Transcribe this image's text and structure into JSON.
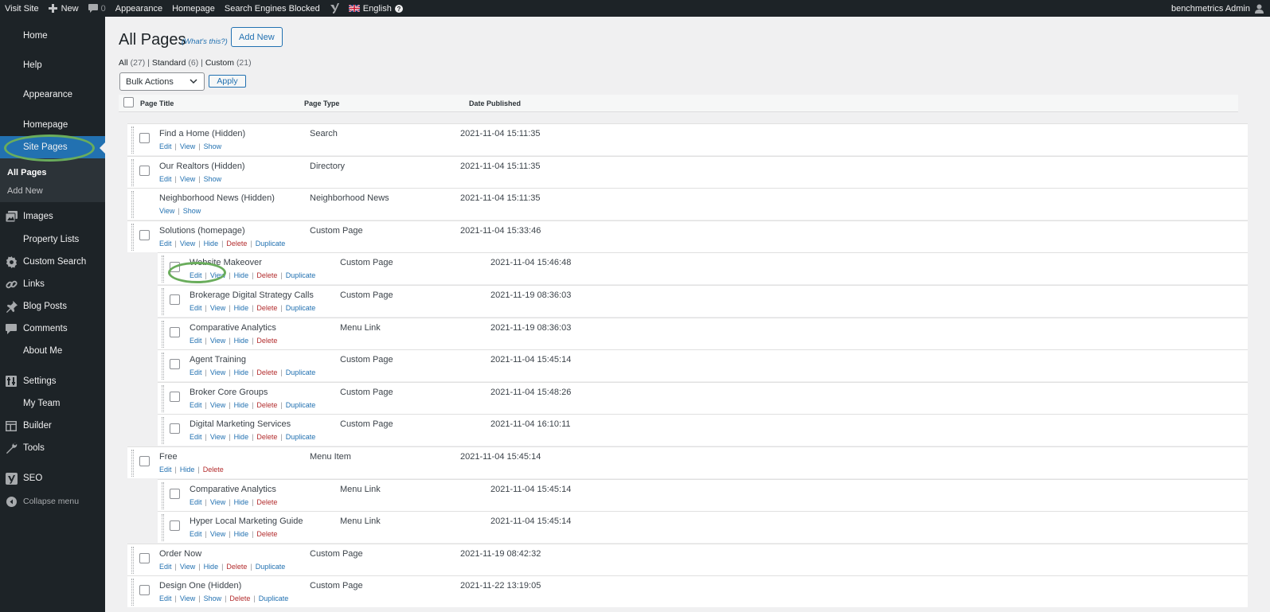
{
  "admin_bar": {
    "visit_site": "Visit Site",
    "new": "New",
    "comments_count": "0",
    "appearance": "Appearance",
    "homepage": "Homepage",
    "search_engines": "Search Engines Blocked",
    "language": "English",
    "user": "benchmetrics Admin"
  },
  "sidebar": {
    "items": [
      {
        "label": "Home",
        "icon": "none"
      },
      {
        "label": "Help",
        "icon": "none"
      },
      {
        "label": "Appearance",
        "icon": "none"
      },
      {
        "label": "Homepage",
        "icon": "none"
      },
      {
        "label": "Site Pages",
        "icon": "none"
      },
      {
        "label": "Images",
        "icon": "images-icon"
      },
      {
        "label": "Property Lists",
        "icon": "none"
      },
      {
        "label": "Custom Search",
        "icon": "gear-icon"
      },
      {
        "label": "Links",
        "icon": "link-icon"
      },
      {
        "label": "Blog Posts",
        "icon": "pin-icon"
      },
      {
        "label": "Comments",
        "icon": "comment-icon"
      },
      {
        "label": "About Me",
        "icon": "none"
      },
      {
        "label": "Settings",
        "icon": "settings-icon"
      },
      {
        "label": "My Team",
        "icon": "none"
      },
      {
        "label": "Builder",
        "icon": "builder-icon"
      },
      {
        "label": "Tools",
        "icon": "wrench-icon"
      },
      {
        "label": "SEO",
        "icon": "yoast-icon"
      },
      {
        "label": "Collapse menu",
        "icon": "collapse-icon"
      }
    ],
    "submenu": [
      "All Pages",
      "Add New"
    ]
  },
  "page": {
    "title": "All Pages",
    "whats_this": "(What's this?)",
    "add_new": "Add New",
    "filters": {
      "all": "All",
      "all_count": "(27)",
      "standard": "Standard",
      "standard_count": "(6)",
      "custom": "Custom",
      "custom_count": "(21)"
    },
    "bulk_actions": "Bulk Actions",
    "apply": "Apply",
    "columns": [
      "Page Title",
      "Page Type",
      "Date Published"
    ]
  },
  "rows": [
    {
      "title": "Find a Home (Hidden)",
      "type": "Search",
      "date": "2021-11-04 15:11:35",
      "actions": [
        "Edit",
        "View",
        "Show"
      ]
    },
    {
      "title": "Our Realtors (Hidden)",
      "type": "Directory",
      "date": "2021-11-04 15:11:35",
      "actions": [
        "Edit",
        "View",
        "Show"
      ]
    },
    {
      "title": "Neighborhood News (Hidden)",
      "type": "Neighborhood News",
      "date": "2021-11-04 15:11:35",
      "actions": [
        "View",
        "Show"
      ]
    },
    {
      "title": "Solutions (homepage)",
      "type": "Custom Page",
      "date": "2021-11-04 15:33:46",
      "actions": [
        "Edit",
        "View",
        "Hide",
        "Delete",
        "Duplicate"
      ]
    },
    {
      "title": "Website Makeover",
      "type": "Custom Page",
      "date": "2021-11-04 15:46:48",
      "actions": [
        "Edit",
        "View",
        "Hide",
        "Delete",
        "Duplicate"
      ]
    },
    {
      "title": "Brokerage Digital Strategy Calls",
      "type": "Custom Page",
      "date": "2021-11-19 08:36:03",
      "actions": [
        "Edit",
        "View",
        "Hide",
        "Delete",
        "Duplicate"
      ]
    },
    {
      "title": "Comparative Analytics",
      "type": "Menu Link",
      "date": "2021-11-19 08:36:03",
      "actions": [
        "Edit",
        "View",
        "Hide",
        "Delete"
      ]
    },
    {
      "title": "Agent Training",
      "type": "Custom Page",
      "date": "2021-11-04 15:45:14",
      "actions": [
        "Edit",
        "View",
        "Hide",
        "Delete",
        "Duplicate"
      ]
    },
    {
      "title": "Broker Core Groups",
      "type": "Custom Page",
      "date": "2021-11-04 15:48:26",
      "actions": [
        "Edit",
        "View",
        "Hide",
        "Delete",
        "Duplicate"
      ]
    },
    {
      "title": "Digital Marketing Services",
      "type": "Custom Page",
      "date": "2021-11-04 16:10:11",
      "actions": [
        "Edit",
        "View",
        "Hide",
        "Delete",
        "Duplicate"
      ]
    },
    {
      "title": "Free",
      "type": "Menu Item",
      "date": "2021-11-04 15:45:14",
      "actions": [
        "Edit",
        "Hide",
        "Delete"
      ]
    },
    {
      "title": "Comparative Analytics",
      "type": "Menu Link",
      "date": "2021-11-04 15:45:14",
      "actions": [
        "Edit",
        "View",
        "Hide",
        "Delete"
      ]
    },
    {
      "title": "Hyper Local Marketing Guide",
      "type": "Menu Link",
      "date": "2021-11-04 15:45:14",
      "actions": [
        "Edit",
        "View",
        "Hide",
        "Delete"
      ]
    },
    {
      "title": "Order Now",
      "type": "Custom Page",
      "date": "2021-11-19 08:42:32",
      "actions": [
        "Edit",
        "View",
        "Hide",
        "Delete",
        "Duplicate"
      ]
    },
    {
      "title": "Design One (Hidden)",
      "type": "Custom Page",
      "date": "2021-11-22 13:19:05",
      "actions": [
        "Edit",
        "View",
        "Show",
        "Delete",
        "Duplicate"
      ]
    }
  ],
  "colors": {
    "admin_bar": "#1d2327",
    "sidebar_current": "#2271b1",
    "link": "#2271b1",
    "delete": "#b32d2e",
    "highlight": "#6aad5c"
  }
}
